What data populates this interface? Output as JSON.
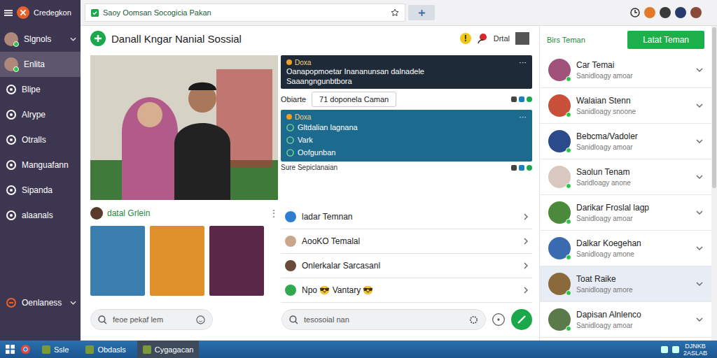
{
  "browser": {
    "address": "Saoy Oomsan Socogicia Pakan"
  },
  "app": {
    "name": "Credegkon"
  },
  "sidebar": {
    "items": [
      {
        "label": "Slgnols",
        "kind": "avatar",
        "selected": false,
        "expandable": true
      },
      {
        "label": "Enlita",
        "kind": "avatar",
        "selected": true,
        "expandable": false
      },
      {
        "label": "Blipe",
        "kind": "icon",
        "selected": false,
        "expandable": false
      },
      {
        "label": "Alrype",
        "kind": "icon",
        "selected": false,
        "expandable": false
      },
      {
        "label": "Otralls",
        "kind": "icon",
        "selected": false,
        "expandable": false
      },
      {
        "label": "Manguafann",
        "kind": "icon",
        "selected": false,
        "expandable": false
      },
      {
        "label": "Sipanda",
        "kind": "icon",
        "selected": false,
        "expandable": false
      },
      {
        "label": "alaanals",
        "kind": "icon",
        "selected": false,
        "expandable": false
      }
    ],
    "footer": {
      "label": "Oenlaness",
      "expandable": true
    }
  },
  "page": {
    "title": "Danall Kngar Nanial Sossial",
    "alert": "!",
    "action": "Drtal"
  },
  "feed": {
    "posts": [
      {
        "kind": "message",
        "author": "Doxa",
        "menu": "···",
        "lines": [
          "Oanapopmoetar Inananunsan dalnadele",
          "Saaangngunbtbora"
        ]
      },
      {
        "kind": "list",
        "author": "Doxa",
        "menu": "···",
        "items": [
          "Gltdalian lagnana",
          "Vark",
          "Oofgunban"
        ]
      }
    ],
    "between": {
      "label": "Obiarte",
      "chip": "71 doponela Caman"
    },
    "footer": "Sure Sepiclanaian"
  },
  "gallery": {
    "title": "datal Grlein",
    "menu": "⋮",
    "cards": [
      {
        "color": "#3a7fb0"
      },
      {
        "color": "#e0902a"
      },
      {
        "color": "#5b2748"
      }
    ]
  },
  "links": [
    {
      "label": "ladar Temnan",
      "color": "#2f7fd0"
    },
    {
      "label": "AooKO Temalal",
      "color": "#c9a68a"
    },
    {
      "label": "Onlerkalar Sarcasanl",
      "color": "#6a4a3a"
    },
    {
      "label": "Npo 😎 Vantary 😎",
      "color": "#2fa84f"
    }
  ],
  "search": {
    "left": "feoe pekaf lem",
    "right": "tesosoial nan"
  },
  "friends": {
    "title": "Birs Teman",
    "button": "Latat Teman",
    "items": [
      {
        "name": "Car Temai",
        "status": "Sanidloagy amoar",
        "selected": false,
        "color": "#a0527a"
      },
      {
        "name": "Walaian Stenn",
        "status": "Sanidloagy snoone",
        "selected": false,
        "color": "#c8503a"
      },
      {
        "name": "Bebcma/Vadoler",
        "status": "Sanidloagy amoar",
        "selected": false,
        "color": "#2a4a8a"
      },
      {
        "name": "Saolun Tenam",
        "status": "Saridloagy anone",
        "selected": false,
        "color": "#d8c8c0"
      },
      {
        "name": "Darikar Froslal lagp",
        "status": "Sanidloagy amoar",
        "selected": false,
        "color": "#4a8a3a"
      },
      {
        "name": "Dalkar Koegehan",
        "status": "Sanidloagy amone",
        "selected": false,
        "color": "#3a6ab0"
      },
      {
        "name": "Toat Raike",
        "status": "Sanidloagy amore",
        "selected": true,
        "color": "#8a6a3a"
      },
      {
        "name": "Dapisan Alnlenco",
        "status": "Sanidloagy amoar",
        "selected": false,
        "color": "#5a7a4a"
      }
    ]
  },
  "taskbar": {
    "items": [
      {
        "label": "Ssle",
        "selected": false
      },
      {
        "label": "Obdasls",
        "selected": false
      },
      {
        "label": "Cygagacan",
        "selected": true
      }
    ],
    "clock": [
      "DJNKB",
      "2ASLAB"
    ]
  }
}
